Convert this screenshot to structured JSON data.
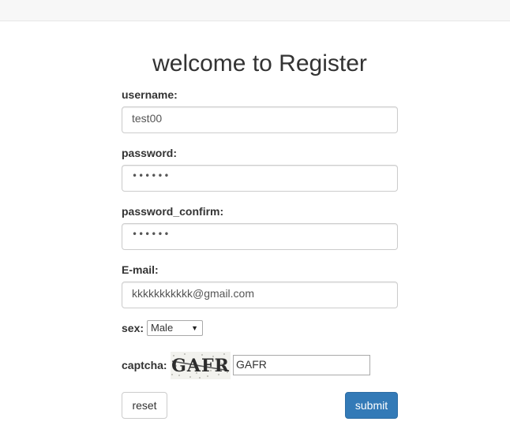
{
  "page": {
    "title": "welcome to Register"
  },
  "form": {
    "username_label": "username:",
    "username_value": "test00",
    "password_label": "password:",
    "password_value": "••••••",
    "password_confirm_label": "password_confirm:",
    "password_confirm_value": "••••••",
    "email_label": "E-mail:",
    "email_value": "kkkkkkkkkkk@gmail.com",
    "sex_label": "sex:",
    "sex_selected": "Male",
    "captcha_label": "captcha:",
    "captcha_image_text": "GAFR",
    "captcha_value": "GAFR",
    "reset_label": "reset",
    "submit_label": "submit"
  },
  "colors": {
    "submit_bg": "#337ab7",
    "topbar_bg": "#f7f7f7"
  },
  "icons": {
    "select_arrow": "chevron-down-icon"
  }
}
